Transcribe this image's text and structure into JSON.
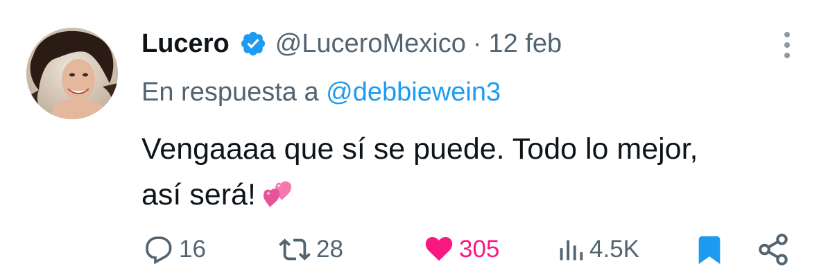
{
  "tweet": {
    "author_name": "Lucero",
    "handle": "@LuceroMexico",
    "separator": "·",
    "date": "12 feb",
    "reply_prefix": "En respuesta a",
    "reply_to": "@debbiewein3",
    "text_line1": "Vengaaaa que sí se puede. Todo lo mejor,",
    "text_line2": "así será!"
  },
  "actions": {
    "replies": "16",
    "retweets": "28",
    "likes": "305",
    "views": "4.5K"
  },
  "icons": {
    "verified": "verified-badge-icon",
    "more": "more-vertical-icon",
    "reply": "reply-icon",
    "retweet": "retweet-icon",
    "like": "heart-filled-icon",
    "views": "views-icon",
    "bookmark": "bookmark-filled-icon",
    "share": "share-icon",
    "emoji": "two-hearts-emoji"
  },
  "colors": {
    "accent": "#1d9bf0",
    "like": "#f91880",
    "secondary_text": "#536471",
    "primary_text": "#0f1419"
  }
}
